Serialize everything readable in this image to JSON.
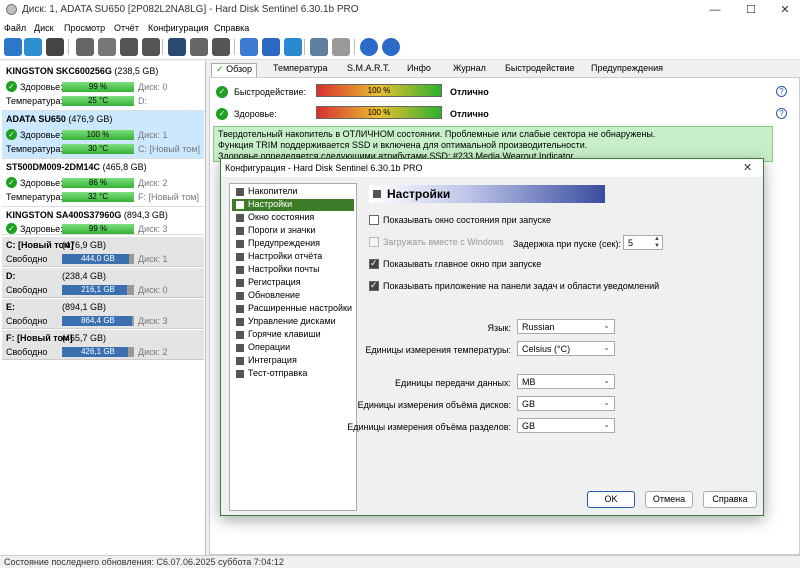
{
  "window": {
    "title": "Диск: 1, ADATA SU650 [2P082L2NA8LG]  -  Hard Disk Sentinel 6.30.1b PRO"
  },
  "menu": [
    "Файл",
    "Диск",
    "Просмотр",
    "Отчёт",
    "Конфигурация",
    "Справка"
  ],
  "disks": [
    {
      "name": "KINGSTON SKC600256G",
      "size": "(238,5 GB)",
      "health_label": "Здоровье:",
      "health": "99 %",
      "health_side": "Диск: 0",
      "temp_label": "Температура:",
      "temp": "25 °C",
      "temp_side": "D:"
    },
    {
      "name": "ADATA SU650",
      "size": "(476,9 GB)",
      "health_label": "Здоровье:",
      "health": "100 %",
      "health_side": "Диск: 1",
      "temp_label": "Температура:",
      "temp": "30 °C",
      "temp_side": "C: [Новый том]"
    },
    {
      "name": "ST500DM009-2DM14C",
      "size": "(465,8 GB)",
      "health_label": "Здоровье:",
      "health": "86 %",
      "health_side": "Диск: 2",
      "temp_label": "Температура:",
      "temp": "32 °C",
      "temp_side": "F: [Новый том]"
    },
    {
      "name": "KINGSTON SA400S37960G",
      "size": "(894,3 GB)",
      "health_label": "Здоровье:",
      "health": "99 %",
      "health_side": "Диск: 3"
    }
  ],
  "volumes": [
    {
      "name": "C: [Новый том]",
      "size": "(476,9 GB)",
      "free_label": "Свободно",
      "free": "444,0 GB",
      "free_fraction": 0.93,
      "disk": "Диск: 1"
    },
    {
      "name": "D:",
      "size": "(238,4 GB)",
      "free_label": "Свободно",
      "free": "216,1 GB",
      "free_fraction": 0.9,
      "disk": "Диск: 0"
    },
    {
      "name": "E:",
      "size": "(894,1 GB)",
      "free_label": "Свободно",
      "free": "864,4 GB",
      "free_fraction": 0.97,
      "disk": "Диск: 3"
    },
    {
      "name": "F: [Новый том]",
      "size": "(465,7 GB)",
      "free_label": "Свободно",
      "free": "426,1 GB",
      "free_fraction": 0.91,
      "disk": "Диск: 2"
    }
  ],
  "tabs": [
    "Обзор",
    "Температура",
    "S.M.A.R.T.",
    "Инфо",
    "Журнал",
    "Быстродействие",
    "Предупреждения"
  ],
  "overview": {
    "perf_label": "Быстродействие:",
    "perf_value": "100 %",
    "perf_status": "Отлично",
    "health_label": "Здоровье:",
    "health_value": "100 %",
    "health_status": "Отлично",
    "status_lines": [
      "Твердотельный накопитель в ОТЛИЧНОМ состоянии. Проблемные или слабые сектора не обнаружены.",
      "Функция TRIM поддерживается SSD и включена для оптимальной производительности.",
      "Здоровье определяется следующими атрибутами SSD: #233 Media Wearout Indicator"
    ]
  },
  "statusbar": {
    "text": "Состояние последнего обновления: С6.07.06.2025 суббота 7:04:12"
  },
  "dialog": {
    "title": "Конфигурация  -  Hard Disk Sentinel 6.30.1b PRO",
    "header": "Настройки",
    "nav": [
      "Накопители",
      "Настройки",
      "Окно состояния",
      "Пороги и значки",
      "Предупреждения",
      "Настройки отчёта",
      "Настройки почты",
      "Регистрация",
      "Обновление",
      "Расширенные настройки",
      "Управление дисками",
      "Горячие клавиши",
      "Операции",
      "Интеграция",
      "Тест-отправка"
    ],
    "opt_show_status": "Показывать окно состояния при запуске",
    "opt_load_with_windows": "Загружать вместе с Windows",
    "delay_label": "Задержка при пуске (сек):",
    "delay_value": "5",
    "opt_show_main": "Показывать главное окно при запуске",
    "opt_show_taskbar": "Показывать приложение на панели задач и области уведомлений",
    "language_label": "Язык:",
    "language_value": "Russian",
    "temp_units_label": "Единицы измерения температуры:",
    "temp_units_value": "Celsius (°C)",
    "transfer_label": "Единицы передачи данных:",
    "transfer_value": "MB",
    "disk_units_label": "Единицы измерения объёма дисков:",
    "disk_units_value": "GB",
    "part_units_label": "Единицы измерения объёма разделов:",
    "part_units_value": "GB",
    "ok": "OK",
    "cancel": "Отмена",
    "help": "Справка"
  }
}
